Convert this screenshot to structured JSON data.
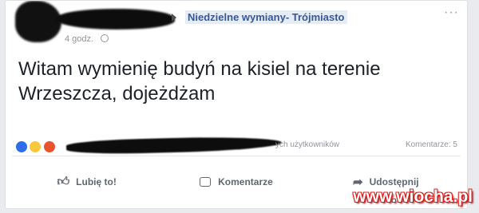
{
  "post": {
    "group_name": "Niedzielne wymiany- Trójmiasto",
    "timestamp": "4 godz.",
    "more_label": "···",
    "text": "Witam wymienię budyń na kisiel na terenie Wrzeszcza, dojeżdżam",
    "reactions_text": "ych użytkowników",
    "comments_text": "Komentarze: 5"
  },
  "actions": {
    "like_label": "Lubię to!",
    "comment_label": "Komentarze",
    "share_label": "Udostępnij"
  },
  "reaction_colors": {
    "like": "#2d6ee8",
    "haha": "#f7c93b",
    "angry": "#e8532d"
  },
  "watermark": "www.wiocha.pl"
}
